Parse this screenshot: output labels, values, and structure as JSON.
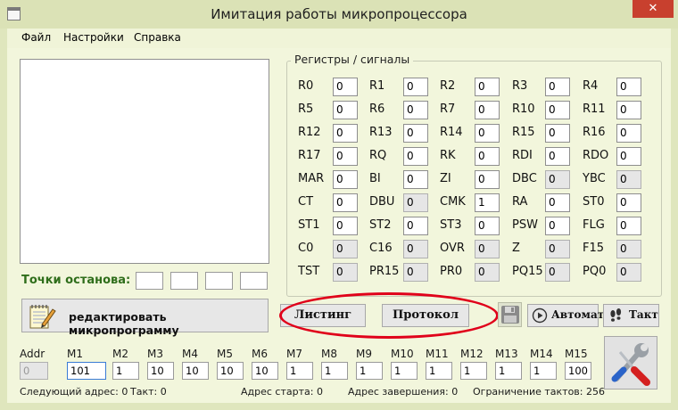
{
  "window": {
    "title": "Имитация работы микропроцессора",
    "close_glyph": "✕"
  },
  "menu": [
    "Файл",
    "Настройки",
    "Справка"
  ],
  "breakpoints": {
    "label": "Точки останова:"
  },
  "registers_group": {
    "title": "Регистры / сигналы"
  },
  "registers": [
    [
      {
        "name": "R0",
        "value": "0",
        "ro": false
      },
      {
        "name": "R1",
        "value": "0",
        "ro": false
      },
      {
        "name": "R2",
        "value": "0",
        "ro": false
      },
      {
        "name": "R3",
        "value": "0",
        "ro": false
      },
      {
        "name": "R4",
        "value": "0",
        "ro": false
      }
    ],
    [
      {
        "name": "R5",
        "value": "0",
        "ro": false
      },
      {
        "name": "R6",
        "value": "0",
        "ro": false
      },
      {
        "name": "R7",
        "value": "0",
        "ro": false
      },
      {
        "name": "R10",
        "value": "0",
        "ro": false
      },
      {
        "name": "R11",
        "value": "0",
        "ro": false
      }
    ],
    [
      {
        "name": "R12",
        "value": "0",
        "ro": false
      },
      {
        "name": "R13",
        "value": "0",
        "ro": false
      },
      {
        "name": "R14",
        "value": "0",
        "ro": false
      },
      {
        "name": "R15",
        "value": "0",
        "ro": false
      },
      {
        "name": "R16",
        "value": "0",
        "ro": false
      }
    ],
    [
      {
        "name": "R17",
        "value": "0",
        "ro": false
      },
      {
        "name": "RQ",
        "value": "0",
        "ro": false
      },
      {
        "name": "RK",
        "value": "0",
        "ro": false
      },
      {
        "name": "RDI",
        "value": "0",
        "ro": false
      },
      {
        "name": "RDO",
        "value": "0",
        "ro": false
      }
    ],
    [
      {
        "name": "MAR",
        "value": "0",
        "ro": false
      },
      {
        "name": "BI",
        "value": "0",
        "ro": false
      },
      {
        "name": "ZI",
        "value": "0",
        "ro": false
      },
      {
        "name": "DBC",
        "value": "0",
        "ro": true
      },
      {
        "name": "YBC",
        "value": "0",
        "ro": true
      }
    ],
    [
      {
        "name": "CT",
        "value": "0",
        "ro": false
      },
      {
        "name": "DBU",
        "value": "0",
        "ro": true
      },
      {
        "name": "CMK",
        "value": "1",
        "ro": false
      },
      {
        "name": "RA",
        "value": "0",
        "ro": false
      },
      {
        "name": "ST0",
        "value": "0",
        "ro": false
      }
    ],
    [
      {
        "name": "ST1",
        "value": "0",
        "ro": false
      },
      {
        "name": "ST2",
        "value": "0",
        "ro": false
      },
      {
        "name": "ST3",
        "value": "0",
        "ro": false
      },
      {
        "name": "PSW",
        "value": "0",
        "ro": false
      },
      {
        "name": "FLG",
        "value": "0",
        "ro": false
      }
    ],
    [
      {
        "name": "C0",
        "value": "0",
        "ro": true
      },
      {
        "name": "C16",
        "value": "0",
        "ro": true
      },
      {
        "name": "OVR",
        "value": "0",
        "ro": true
      },
      {
        "name": "Z",
        "value": "0",
        "ro": true
      },
      {
        "name": "F15",
        "value": "0",
        "ro": true
      }
    ],
    [
      {
        "name": "TST",
        "value": "0",
        "ro": true
      },
      {
        "name": "PR15",
        "value": "0",
        "ro": true
      },
      {
        "name": "PR0",
        "value": "0",
        "ro": true
      },
      {
        "name": "PQ15",
        "value": "0",
        "ro": true
      },
      {
        "name": "PQ0",
        "value": "0",
        "ro": true
      }
    ]
  ],
  "buttons": {
    "edit_microprogram": "редактировать микропрограмму",
    "listing": "Листинг",
    "protocol": "Протокол",
    "auto": "Автомат",
    "step": "Такт"
  },
  "microcode_fields": [
    {
      "label": "Addr",
      "value": "0",
      "state": "ro"
    },
    {
      "label": "M1",
      "value": "101",
      "state": "sel"
    },
    {
      "label": "M2",
      "value": "1",
      "state": ""
    },
    {
      "label": "M3",
      "value": "10",
      "state": ""
    },
    {
      "label": "M4",
      "value": "10",
      "state": ""
    },
    {
      "label": "M5",
      "value": "10",
      "state": ""
    },
    {
      "label": "M6",
      "value": "10",
      "state": ""
    },
    {
      "label": "M7",
      "value": "1",
      "state": ""
    },
    {
      "label": "M8",
      "value": "1",
      "state": ""
    },
    {
      "label": "M9",
      "value": "1",
      "state": ""
    },
    {
      "label": "M10",
      "value": "1",
      "state": ""
    },
    {
      "label": "M11",
      "value": "1",
      "state": ""
    },
    {
      "label": "M12",
      "value": "1",
      "state": ""
    },
    {
      "label": "M13",
      "value": "1",
      "state": ""
    },
    {
      "label": "M14",
      "value": "1",
      "state": ""
    },
    {
      "label": "M15",
      "value": "100",
      "state": ""
    }
  ],
  "status": {
    "next_address": "Следующий адрес: 0",
    "tact": "Такт: 0",
    "start_address": "Адрес старта: 0",
    "end_address": "Адрес завершения: 0",
    "tact_limit": "Ограничение тактов: 256"
  },
  "colors": {
    "background": "#f2f6dc",
    "breakpoint_label": "#2f6e1b",
    "highlight": "#e0001a",
    "close": "#c8402e"
  },
  "icons": [
    "app-icon",
    "notepad-pencil-icon",
    "floppy-disk-icon",
    "play-icon",
    "footprints-icon",
    "wrench-screwdriver-icon"
  ]
}
